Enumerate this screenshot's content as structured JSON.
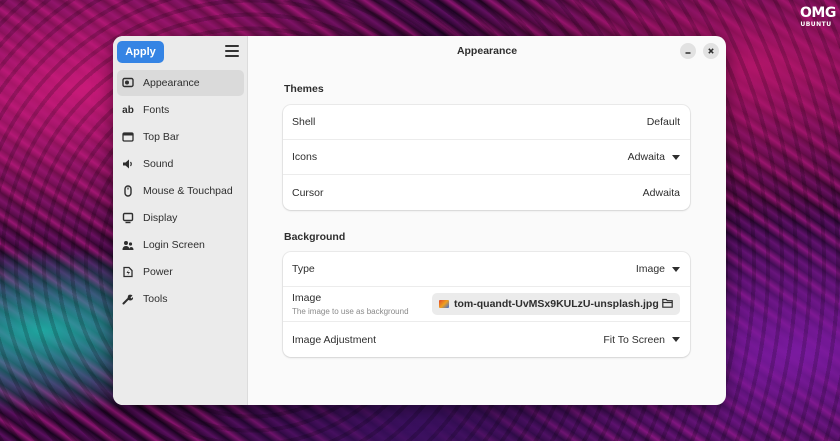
{
  "logo": {
    "line1": "OMG",
    "line2": "UBUNTU"
  },
  "toolbar": {
    "apply_label": "Apply"
  },
  "window": {
    "title": "Appearance"
  },
  "sidebar": {
    "items": [
      {
        "label": "Appearance",
        "icon": "appearance-icon",
        "active": true
      },
      {
        "label": "Fonts",
        "icon": "fonts-icon"
      },
      {
        "label": "Top Bar",
        "icon": "top-bar-icon"
      },
      {
        "label": "Sound",
        "icon": "sound-icon"
      },
      {
        "label": "Mouse & Touchpad",
        "icon": "mouse-icon"
      },
      {
        "label": "Display",
        "icon": "display-icon"
      },
      {
        "label": "Login Screen",
        "icon": "users-icon"
      },
      {
        "label": "Power",
        "icon": "power-icon"
      },
      {
        "label": "Tools",
        "icon": "tools-icon"
      }
    ]
  },
  "themes": {
    "heading": "Themes",
    "shell": {
      "label": "Shell",
      "value": "Default"
    },
    "icons": {
      "label": "Icons",
      "value": "Adwaita"
    },
    "cursor": {
      "label": "Cursor",
      "value": "Adwaita"
    }
  },
  "background": {
    "heading": "Background",
    "type": {
      "label": "Type",
      "value": "Image"
    },
    "image": {
      "label": "Image",
      "sublabel": "The image to use as background",
      "file": "tom-quandt-UvMSx9KULzU-unsplash.jpg"
    },
    "adjustment": {
      "label": "Image Adjustment",
      "value": "Fit To Screen"
    }
  },
  "colors": {
    "accent": "#3584e4",
    "sidebar_bg": "#ebebeb",
    "content_bg": "#fafafa"
  }
}
